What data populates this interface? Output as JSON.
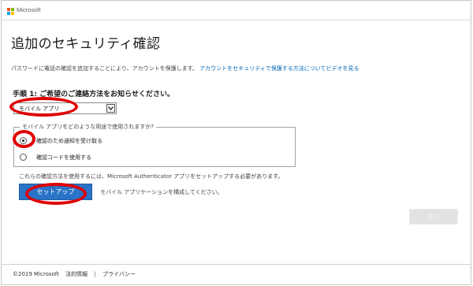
{
  "header": {
    "brand": "Microsoft"
  },
  "page": {
    "title": "追加のセキュリティ確認",
    "intro_text": "パスワードに電話の確認を追加することにより、アカウントを保護します。",
    "intro_link": "アカウントをセキュリティで保護する方法についてビデオを見る"
  },
  "step1": {
    "heading": "手順 1: ご希望のご連絡方法をお知らせください。",
    "method_select": {
      "value": "モバイル アプリ"
    }
  },
  "usage": {
    "legend": "モバイル アプリをどのような用途で使用されますか?",
    "options": [
      {
        "label": "確認のため通知を受け取る",
        "checked": true
      },
      {
        "label": "確認コードを使用する",
        "checked": false
      }
    ]
  },
  "authenticator": {
    "note": "これらの確認方法を使用するには、Microsoft Authenticator アプリをセットアップする必要があります。",
    "setup_label": "セットアップ",
    "setup_hint": "モバイル アプリケーションを構成してください。"
  },
  "actions": {
    "next_label": "次へ"
  },
  "footer": {
    "copyright": "©2019 Microsoft",
    "legal": "法的情報",
    "separator": "|",
    "privacy": "プライバシー"
  },
  "colors": {
    "accent": "#2a73c7",
    "link": "#0067b8",
    "annotation": "#e00000",
    "logo": [
      "#f25022",
      "#7fba00",
      "#00a4ef",
      "#ffb900"
    ]
  }
}
